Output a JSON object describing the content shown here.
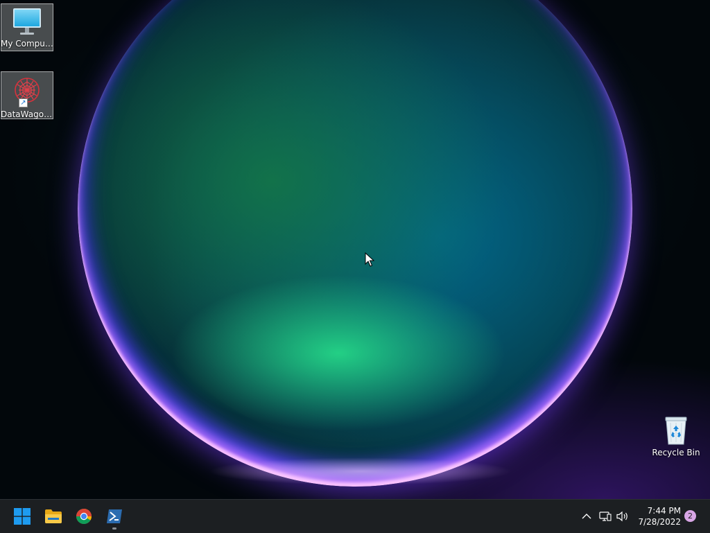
{
  "desktop": {
    "icons": [
      {
        "label": "My Computer",
        "icon": "monitor-icon"
      },
      {
        "label": "DataWagon...",
        "icon": "datawagon-logo-icon"
      },
      {
        "label": "Recycle Bin",
        "icon": "recycle-bin-icon"
      }
    ]
  },
  "taskbar": {
    "buttons": [
      {
        "name": "Start",
        "icon": "windows-logo-icon"
      },
      {
        "name": "File Explorer",
        "icon": "folder-icon"
      },
      {
        "name": "Google Chrome",
        "icon": "chrome-icon"
      },
      {
        "name": "PowerShell",
        "icon": "powershell-icon"
      }
    ],
    "tray": {
      "time": "7:44 PM",
      "date": "7/28/2022",
      "notification_count": "2"
    }
  },
  "colors": {
    "taskbar_bg": "#1c1f22",
    "windows_blue": "#1e9bf0",
    "folder_yellow": "#f7c948",
    "powershell_blue": "#2b6cb0"
  }
}
